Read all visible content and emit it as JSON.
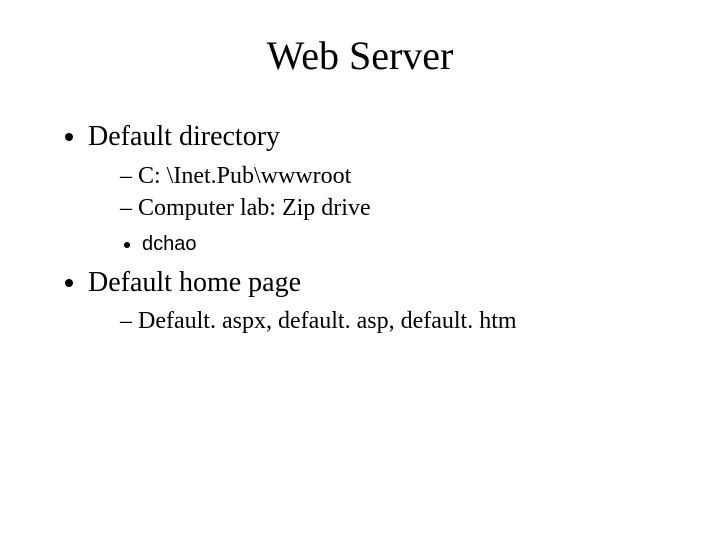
{
  "title": "Web Server",
  "bullets": {
    "item1": {
      "label": "Default directory",
      "sub1": "C: \\Inet.Pub\\wwwroot",
      "sub2": "Computer lab: Zip drive",
      "sub2a": "dchao"
    },
    "item2": {
      "label": "Default home page",
      "sub1": "Default. aspx, default. asp, default. htm"
    }
  }
}
